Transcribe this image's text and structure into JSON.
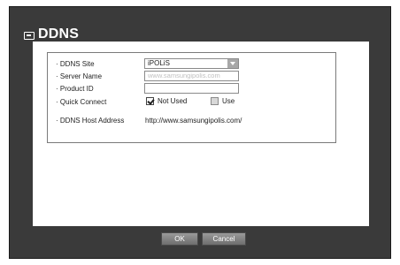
{
  "dialog": {
    "title": "DDNS",
    "icon": "display-icon"
  },
  "form": {
    "ddns_site": {
      "label": "· DDNS Site",
      "value": "iPOLiS"
    },
    "server_name": {
      "label": "· Server Name",
      "placeholder": "www.samsungipolis.com",
      "value": ""
    },
    "product_id": {
      "label": "· Product ID",
      "value": ""
    },
    "quick_connect": {
      "label": "· Quick Connect",
      "options": [
        {
          "label": "Not Used",
          "checked": true
        },
        {
          "label": "Use",
          "checked": false
        }
      ]
    },
    "host_address": {
      "label": "· DDNS Host Address",
      "value": "http://www.samsungipolis.com/"
    }
  },
  "buttons": {
    "ok": "OK",
    "cancel": "Cancel"
  },
  "colors": {
    "frame": "#3a3a3a",
    "content": "#ffffff",
    "button": "#8a8a8a"
  }
}
